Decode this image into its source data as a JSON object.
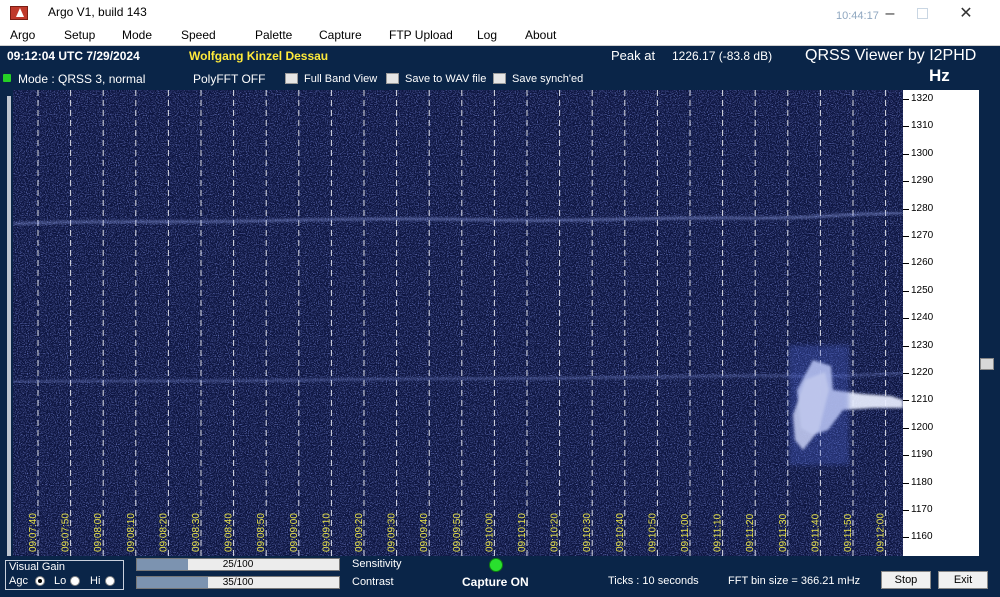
{
  "window": {
    "title": "Argo V1, build 143",
    "clock": "10:44:17",
    "minimize": "–",
    "close": "✕"
  },
  "menu": [
    "Argo",
    "Setup",
    "Mode",
    "Speed",
    "Palette",
    "Capture",
    "FTP Upload",
    "Log",
    "About"
  ],
  "status": {
    "utc_time": "09:12:04 UTC  7/29/2024",
    "operator": "Wolfgang Kinzel Dessau",
    "peak_label": "Peak at",
    "peak_value": "1226.17 (-83.8 dB)",
    "viewer_title": "QRSS Viewer by I2PHD",
    "units": "Hz",
    "mode": "Mode : QRSS 3, normal",
    "polyfft": "PolyFFT OFF"
  },
  "checkboxes": [
    {
      "label": "Full Band View",
      "checked": false
    },
    {
      "label": "Save to WAV file",
      "checked": false
    },
    {
      "label": "Save synch'ed",
      "checked": false
    }
  ],
  "frequency_axis": {
    "labels": [
      "1320",
      "1310",
      "1300",
      "1290",
      "1280",
      "1270",
      "1260",
      "1250",
      "1240",
      "1230",
      "1220",
      "1210",
      "1200",
      "1190",
      "1180",
      "1170",
      "1160"
    ]
  },
  "time_axis": {
    "labels": [
      "09:07:40",
      "09:07:50",
      "09:08:00",
      "09:08:10",
      "09:08:20",
      "09:08:30",
      "09:08:40",
      "09:08:50",
      "09:09:00",
      "09:09:10",
      "09:09:20",
      "09:09:30",
      "09:09:40",
      "09:09:50",
      "09:10:00",
      "09:10:10",
      "09:10:20",
      "09:10:30",
      "09:10:40",
      "09:10:50",
      "09:11:00",
      "09:11:10",
      "09:11:20",
      "09:11:30",
      "09:11:40",
      "09:11:50",
      "09:12:00"
    ],
    "label_color": "#e8e24a"
  },
  "controls": {
    "visual_gain": "Visual Gain",
    "agc": "Agc",
    "lo": "Lo",
    "hi": "Hi",
    "selected": "Agc",
    "sensitivity_label": "Sensitivity",
    "sensitivity_value": "25/100",
    "sensitivity_fraction": 0.25,
    "contrast_label": "Contrast",
    "contrast_value": "35/100",
    "contrast_fraction": 0.35,
    "capture_status": "Capture ON",
    "ticks": "Ticks  : 10 seconds",
    "fft_bin": "FFT bin size = 366.21 mHz",
    "stop": "Stop",
    "exit": "Exit"
  },
  "colors": {
    "background": "#0a2548",
    "spectrogram": "#0d1540",
    "signal": "#c8d4ff",
    "operator": "#ffea3b",
    "capture_led": "#29e02e"
  }
}
